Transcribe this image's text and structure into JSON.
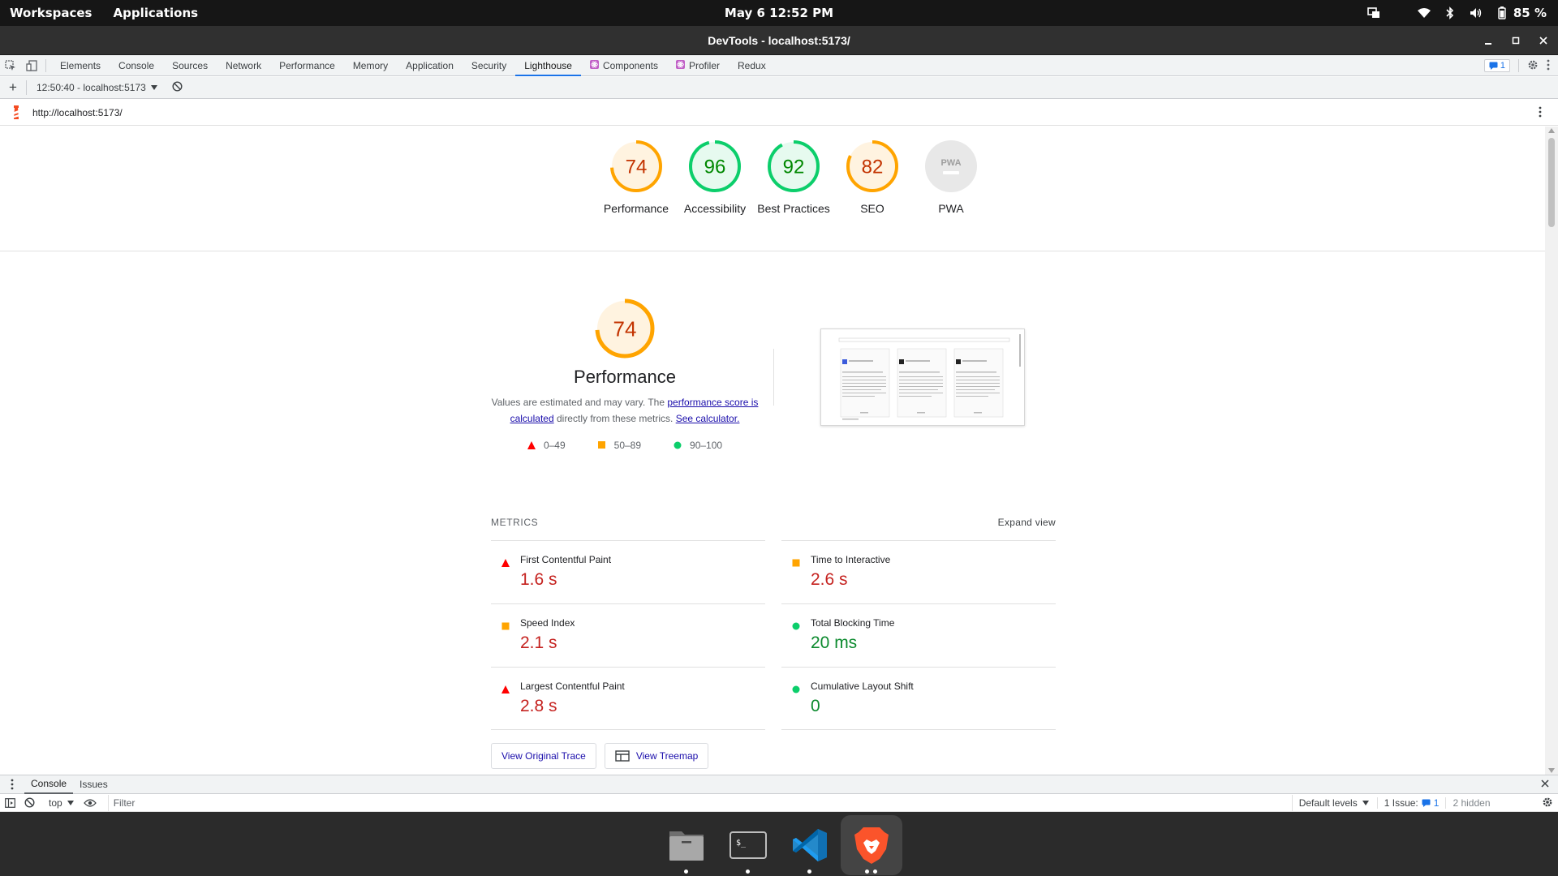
{
  "topbar": {
    "workspaces": "Workspaces",
    "applications": "Applications",
    "clock": "May 6  12:52 PM",
    "battery": "85 %",
    "icons": [
      "screen-share-icon",
      "wifi-icon",
      "bluetooth-icon",
      "volume-icon",
      "battery-icon"
    ]
  },
  "window": {
    "title": "DevTools - localhost:5173/"
  },
  "devtools": {
    "tabs": [
      {
        "label": "Elements"
      },
      {
        "label": "Console"
      },
      {
        "label": "Sources"
      },
      {
        "label": "Network"
      },
      {
        "label": "Performance"
      },
      {
        "label": "Memory"
      },
      {
        "label": "Application"
      },
      {
        "label": "Security"
      },
      {
        "label": "Lighthouse",
        "active": true
      },
      {
        "label": "Components",
        "icon": "react-icon"
      },
      {
        "label": "Profiler",
        "icon": "react-icon"
      },
      {
        "label": "Redux"
      }
    ],
    "issues_count": "1"
  },
  "lighthouse": {
    "run_label": "12:50:40 - localhost:5173",
    "url": "http://localhost:5173/",
    "gauges": [
      {
        "score": "74",
        "label": "Performance",
        "level": "average"
      },
      {
        "score": "96",
        "label": "Accessibility",
        "level": "pass"
      },
      {
        "score": "92",
        "label": "Best Practices",
        "level": "pass"
      },
      {
        "score": "82",
        "label": "SEO",
        "level": "average"
      },
      {
        "score": "",
        "label": "PWA",
        "level": "na",
        "badge": "PWA"
      }
    ],
    "performance": {
      "score": "74",
      "title": "Performance",
      "desc_1": "Values are estimated and may vary. The ",
      "link_1": "performance score is calculated",
      "desc_2": " directly from these metrics. ",
      "link_2": "See calculator.",
      "legend": [
        "0–49",
        "50–89",
        "90–100"
      ]
    },
    "metrics_heading": "METRICS",
    "expand_view": "Expand view",
    "metrics": [
      {
        "name": "First Contentful Paint",
        "value": "1.6 s",
        "rating": "fail"
      },
      {
        "name": "Time to Interactive",
        "value": "2.6 s",
        "rating": "average"
      },
      {
        "name": "Speed Index",
        "value": "2.1 s",
        "rating": "average"
      },
      {
        "name": "Total Blocking Time",
        "value": "20 ms",
        "rating": "pass"
      },
      {
        "name": "Largest Contentful Paint",
        "value": "2.8 s",
        "rating": "fail"
      },
      {
        "name": "Cumulative Layout Shift",
        "value": "0",
        "rating": "pass"
      }
    ],
    "buttons": {
      "view_trace": "View Original Trace",
      "view_treemap": "View Treemap"
    }
  },
  "drawer": {
    "tabs": [
      "Console",
      "Issues"
    ],
    "context": "top",
    "filter_placeholder": "Filter",
    "levels": "Default levels",
    "issues_label": "1 Issue:",
    "issues_count": "1",
    "hidden": "2 hidden"
  },
  "dock": {
    "apps": [
      "files-icon",
      "terminal-icon",
      "vscode-icon",
      "brave-icon"
    ]
  },
  "colors": {
    "fail": "#c5221f",
    "average": "#ffa400",
    "pass": "#0cce6b",
    "accent": "#1a73e8"
  }
}
